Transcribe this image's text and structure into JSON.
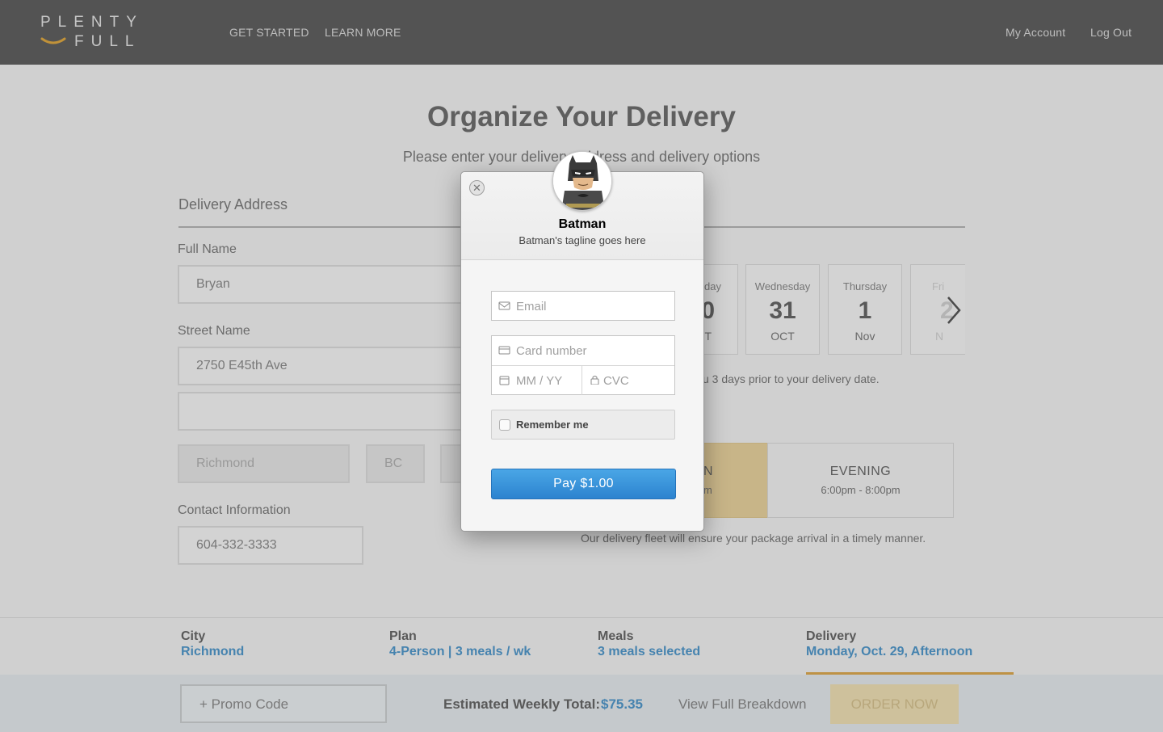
{
  "header": {
    "logo_top": "PLENTY",
    "logo_bottom": "FULL",
    "nav": [
      "GET STARTED",
      "LEARN MORE"
    ],
    "account": "My Account",
    "logout": "Log Out"
  },
  "page": {
    "title": "Organize Your Delivery",
    "subtitle": "Please enter your delivery address and  delivery options"
  },
  "address": {
    "section_title": "Delivery Address",
    "full_name_label": "Full Name",
    "full_name_value": "Bryan",
    "street_label": "Street Name",
    "street_value": "2750 E45th Ave",
    "street2_value": "",
    "city_value": "Richmond",
    "province_value": "BC",
    "contact_label": "Contact Information",
    "contact_value": "604-332-3333"
  },
  "dates": [
    {
      "dow": "day",
      "num": "0",
      "mon": "T"
    },
    {
      "dow": "Wednesday",
      "num": "31",
      "mon": "OCT"
    },
    {
      "dow": "Thursday",
      "num": "1",
      "mon": "Nov"
    },
    {
      "dow": "Fri",
      "num": "2",
      "mon": "N"
    }
  ],
  "notes": {
    "date_note": "u 3 days prior to your delivery date.",
    "fleet_note": "Our delivery fleet will ensure your package arrival in a timely manner."
  },
  "slots": [
    {
      "name": "N",
      "time": "m",
      "selected": true
    },
    {
      "name": "EVENING",
      "time": "6:00pm - 8:00pm",
      "selected": false
    }
  ],
  "summary": {
    "city_label": "City",
    "city_value": "Richmond",
    "plan_label": "Plan",
    "plan_value": "4-Person | 3 meals / wk",
    "meals_label": "Meals",
    "meals_value": "3 meals selected",
    "delivery_label": "Delivery",
    "delivery_value": "Monday, Oct. 29, Afternoon"
  },
  "footer": {
    "promo": "+ Promo Code",
    "est_label": "Estimated Weekly Total:",
    "est_value": "$75.35",
    "breakdown": "View Full Breakdown",
    "order": "ORDER NOW"
  },
  "modal": {
    "close": "✕",
    "name": "Batman",
    "tagline": "Batman's tagline goes here",
    "email_placeholder": "Email",
    "card_placeholder": "Card number",
    "exp_placeholder": "MM / YY",
    "cvc_placeholder": "CVC",
    "remember": "Remember me",
    "pay": "Pay $1.00"
  },
  "colors": {
    "accent_blue": "#3d88bd",
    "selected_slot": "#dcc58e",
    "pay_button": "#2c83cf"
  }
}
